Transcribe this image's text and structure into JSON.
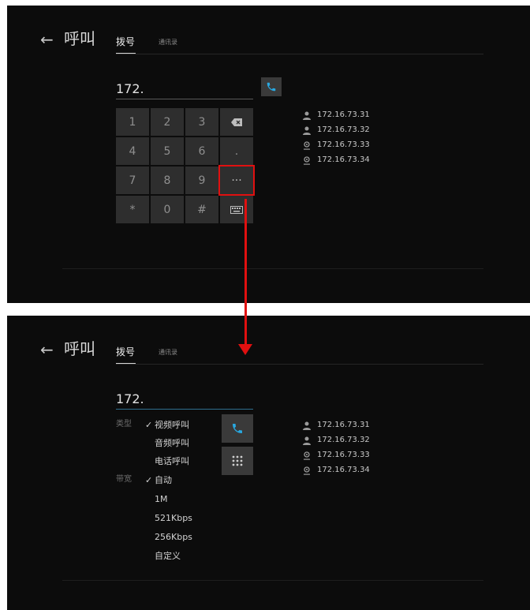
{
  "header": {
    "back_glyph": "←",
    "title": "呼叫",
    "tabs": [
      {
        "label": "拨号",
        "active": true
      },
      {
        "label": "通讯录",
        "active": false
      }
    ]
  },
  "dialer": {
    "input_value": "172.",
    "keys": [
      "1",
      "2",
      "3",
      "⌫",
      "4",
      "5",
      "6",
      ".",
      "7",
      "8",
      "9",
      "···",
      "*",
      "0",
      "#",
      "⌨"
    ]
  },
  "contacts": [
    {
      "address": "172.16.73.31",
      "icon": "person-icon"
    },
    {
      "address": "172.16.73.32",
      "icon": "person-icon"
    },
    {
      "address": "172.16.73.33",
      "icon": "location-pin-icon"
    },
    {
      "address": "172.16.73.34",
      "icon": "location-pin-icon"
    }
  ],
  "options": {
    "type_label": "类型",
    "type_items": [
      {
        "label": "视频呼叫",
        "selected": true
      },
      {
        "label": "音频呼叫",
        "selected": false
      },
      {
        "label": "电话呼叫",
        "selected": false
      }
    ],
    "bandwidth_label": "带宽",
    "bandwidth_items": [
      {
        "label": "自动",
        "selected": true
      },
      {
        "label": "1M",
        "selected": false
      },
      {
        "label": "521Kbps",
        "selected": false
      },
      {
        "label": "256Kbps",
        "selected": false
      },
      {
        "label": "自定义",
        "selected": false
      }
    ],
    "check_glyph": "✓"
  },
  "colors": {
    "background": "#0c0c0c",
    "key_bg": "#2e2e2e",
    "accent_blue": "#29a8e0",
    "annotation_red": "#e01010"
  }
}
